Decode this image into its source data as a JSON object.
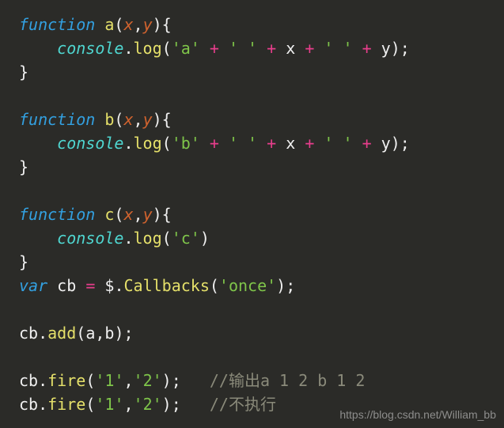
{
  "code": {
    "funcA": {
      "kw": "function",
      "name": "a",
      "p1": "x",
      "p2": "y",
      "log_obj": "console",
      "log_meth": "log",
      "s_a": "'a'",
      "s_sp1": "' '",
      "s_sp2": "' '",
      "ref_x": "x",
      "ref_y": "y"
    },
    "funcB": {
      "kw": "function",
      "name": "b",
      "p1": "x",
      "p2": "y",
      "log_obj": "console",
      "log_meth": "log",
      "s_b": "'b'",
      "s_sp1": "' '",
      "s_sp2": "' '",
      "ref_x": "x",
      "ref_y": "y"
    },
    "funcC": {
      "kw": "function",
      "name": "c",
      "p1": "x",
      "p2": "y",
      "log_obj": "console",
      "log_meth": "log",
      "s_c": "'c'"
    },
    "varDecl": {
      "kw": "var",
      "name": "cb",
      "dollar": "$",
      "callbacks": "Callbacks",
      "arg": "'once'"
    },
    "add": {
      "obj": "cb",
      "meth": "add",
      "a1": "a",
      "a2": "b"
    },
    "fire1": {
      "obj": "cb",
      "meth": "fire",
      "a1": "'1'",
      "a2": "'2'",
      "comment": "//输出a 1 2 b 1 2"
    },
    "fire2": {
      "obj": "cb",
      "meth": "fire",
      "a1": "'1'",
      "a2": "'2'",
      "comment": "//不执行"
    },
    "plus": "+",
    "eq": "="
  },
  "watermark": "https://blog.csdn.net/William_bb"
}
